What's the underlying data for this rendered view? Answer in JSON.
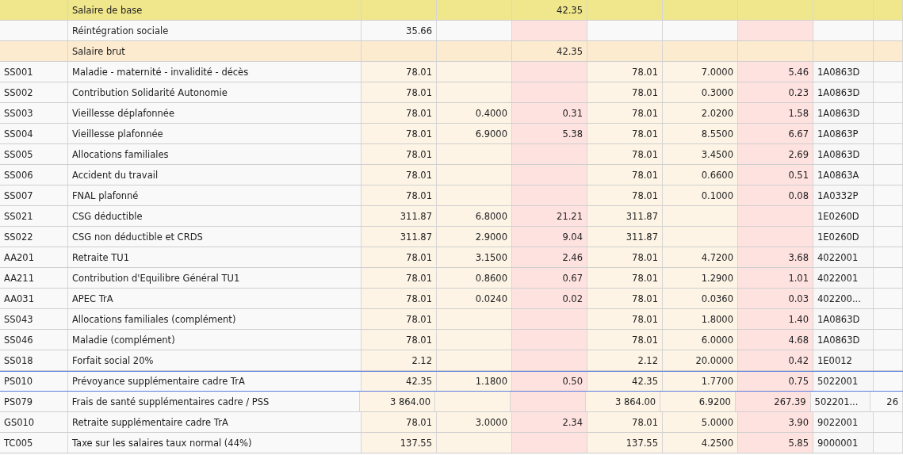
{
  "table": {
    "rows": [
      {
        "kind": "base",
        "selected": false,
        "column_2": "Salaire de base",
        "column_5": "42.35"
      },
      {
        "kind": "plain",
        "selected": false,
        "column_2": "Réintégration sociale",
        "column_3": "35.66"
      },
      {
        "kind": "brut",
        "selected": false,
        "column_2": "Salaire brut",
        "column_5": "42.35"
      },
      {
        "kind": "line",
        "selected": false,
        "column_1": "SS001",
        "column_2": "Maladie - maternité - invalidité - décès",
        "column_3": "78.01",
        "column_6": "78.01",
        "column_7": "7.0000",
        "column_8": "5.46",
        "column_9": "1A0863D"
      },
      {
        "kind": "line",
        "selected": false,
        "column_1": "SS002",
        "column_2": "Contribution Solidarité Autonomie",
        "column_3": "78.01",
        "column_6": "78.01",
        "column_7": "0.3000",
        "column_8": "0.23",
        "column_9": "1A0863D"
      },
      {
        "kind": "line",
        "selected": false,
        "column_1": "SS003",
        "column_2": "Vieillesse déplafonnée",
        "column_3": "78.01",
        "column_4": "0.4000",
        "column_5": "0.31",
        "column_6": "78.01",
        "column_7": "2.0200",
        "column_8": "1.58",
        "column_9": "1A0863D"
      },
      {
        "kind": "line",
        "selected": false,
        "column_1": "SS004",
        "column_2": "Vieillesse plafonnée",
        "column_3": "78.01",
        "column_4": "6.9000",
        "column_5": "5.38",
        "column_6": "78.01",
        "column_7": "8.5500",
        "column_8": "6.67",
        "column_9": "1A0863P"
      },
      {
        "kind": "line",
        "selected": false,
        "column_1": "SS005",
        "column_2": "Allocations familiales",
        "column_3": "78.01",
        "column_6": "78.01",
        "column_7": "3.4500",
        "column_8": "2.69",
        "column_9": "1A0863D"
      },
      {
        "kind": "line",
        "selected": false,
        "column_1": "SS006",
        "column_2": "Accident du travail",
        "column_3": "78.01",
        "column_6": "78.01",
        "column_7": "0.6600",
        "column_8": "0.51",
        "column_9": "1A0863A"
      },
      {
        "kind": "line",
        "selected": false,
        "column_1": "SS007",
        "column_2": "FNAL plafonné",
        "column_3": "78.01",
        "column_6": "78.01",
        "column_7": "0.1000",
        "column_8": "0.08",
        "column_9": "1A0332P"
      },
      {
        "kind": "line",
        "selected": false,
        "column_1": "SS021",
        "column_2": "CSG déductible",
        "column_3": "311.87",
        "column_4": "6.8000",
        "column_5": "21.21",
        "column_6": "311.87",
        "column_9": "1E0260D"
      },
      {
        "kind": "line",
        "selected": false,
        "column_1": "SS022",
        "column_2": "CSG non déductible et CRDS",
        "column_3": "311.87",
        "column_4": "2.9000",
        "column_5": "9.04",
        "column_6": "311.87",
        "column_9": "1E0260D"
      },
      {
        "kind": "line",
        "selected": false,
        "column_1": "AA201",
        "column_2": "Retraite TU1",
        "column_3": "78.01",
        "column_4": "3.1500",
        "column_5": "2.46",
        "column_6": "78.01",
        "column_7": "4.7200",
        "column_8": "3.68",
        "column_9": "4022001"
      },
      {
        "kind": "line",
        "selected": false,
        "column_1": "AA211",
        "column_2": "Contribution d'Equilibre Général TU1",
        "column_3": "78.01",
        "column_4": "0.8600",
        "column_5": "0.67",
        "column_6": "78.01",
        "column_7": "1.2900",
        "column_8": "1.01",
        "column_9": "4022001"
      },
      {
        "kind": "line",
        "selected": false,
        "column_1": "AA031",
        "column_2": "APEC TrA",
        "column_3": "78.01",
        "column_4": "0.0240",
        "column_5": "0.02",
        "column_6": "78.01",
        "column_7": "0.0360",
        "column_8": "0.03",
        "column_9": "402200..."
      },
      {
        "kind": "line",
        "selected": false,
        "column_1": "SS043",
        "column_2": "Allocations familiales (complément)",
        "column_3": "78.01",
        "column_6": "78.01",
        "column_7": "1.8000",
        "column_8": "1.40",
        "column_9": "1A0863D"
      },
      {
        "kind": "line",
        "selected": false,
        "column_1": "SS046",
        "column_2": "Maladie (complément)",
        "column_3": "78.01",
        "column_6": "78.01",
        "column_7": "6.0000",
        "column_8": "4.68",
        "column_9": "1A0863D"
      },
      {
        "kind": "line",
        "selected": false,
        "column_1": "SS018",
        "column_2": "Forfait social 20%",
        "column_3": "2.12",
        "column_6": "2.12",
        "column_7": "20.0000",
        "column_8": "0.42",
        "column_9": "1E0012"
      },
      {
        "kind": "line",
        "selected": true,
        "column_1": "PS010",
        "column_2": "Prévoyance supplémentaire cadre TrA",
        "column_3": "42.35",
        "column_4": "1.1800",
        "column_5": "0.50",
        "column_6": "42.35",
        "column_7": "1.7700",
        "column_8": "0.75",
        "column_9": "5022001"
      },
      {
        "kind": "line",
        "selected": false,
        "column_1": "PS079",
        "column_2": "Frais de santé supplémentaires cadre / PSS",
        "column_3": "3 864.00",
        "column_6": "3 864.00",
        "column_7": "6.9200",
        "column_8": "267.39",
        "column_9": "502201...",
        "column_10": "26"
      },
      {
        "kind": "line",
        "selected": false,
        "column_1": "GS010",
        "column_2": "Retraite supplémentaire cadre TrA",
        "column_3": "78.01",
        "column_4": "3.0000",
        "column_5": "2.34",
        "column_6": "78.01",
        "column_7": "5.0000",
        "column_8": "3.90",
        "column_9": "9022001"
      },
      {
        "kind": "line",
        "selected": false,
        "column_1": "TC005",
        "column_2": "Taxe sur les salaires taux normal (44%)",
        "column_3": "137.55",
        "column_6": "137.55",
        "column_7": "4.2500",
        "column_8": "5.85",
        "column_9": "9000001"
      }
    ]
  }
}
